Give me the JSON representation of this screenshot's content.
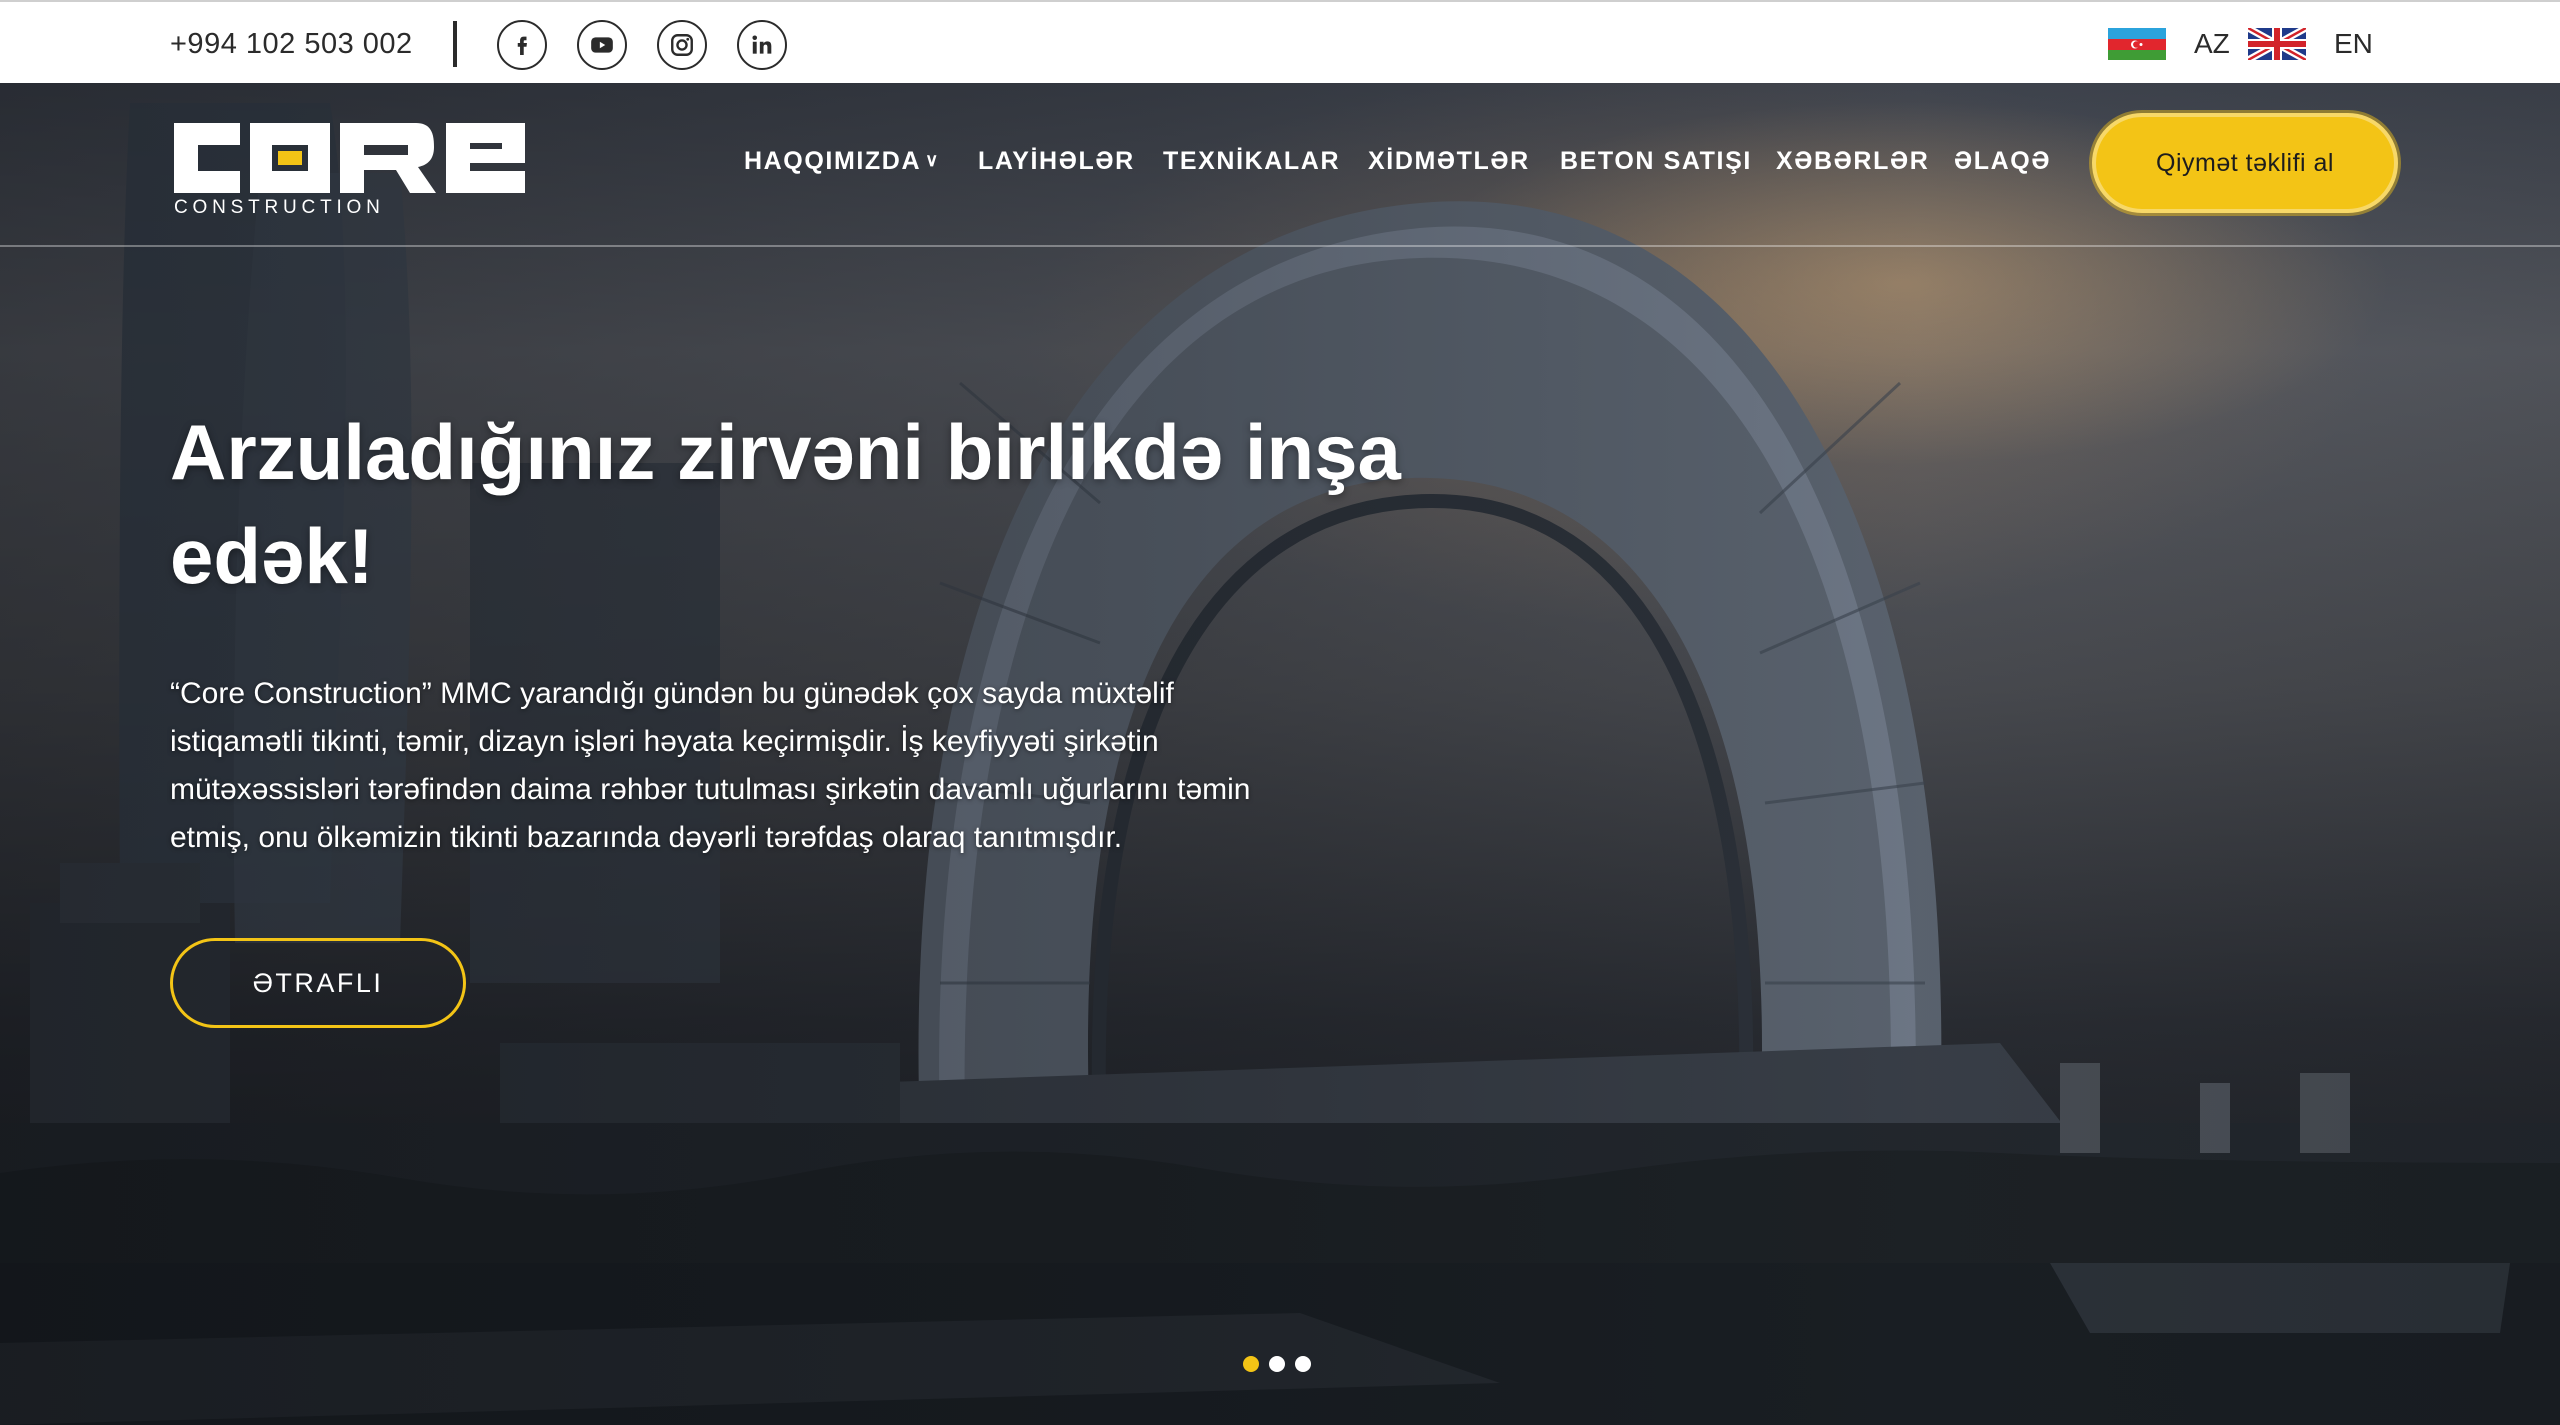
{
  "topbar": {
    "phone": "+994 102 503 002",
    "social": [
      "facebook-icon",
      "youtube-icon",
      "instagram-icon",
      "linkedin-icon"
    ],
    "languages": [
      {
        "code": "AZ",
        "flag": "azerbaijan-flag-icon"
      },
      {
        "code": "EN",
        "flag": "uk-flag-icon"
      }
    ]
  },
  "brand": {
    "name": "CORE",
    "tagline": "CONSTRUCTION",
    "accent_color": "#f3c416"
  },
  "nav": {
    "items": [
      {
        "label": "HAQQIMIZDA",
        "has_dropdown": true
      },
      {
        "label": "LAYİHƏLƏR"
      },
      {
        "label": "TEXNİKALAR"
      },
      {
        "label": "XİDMƏTLƏR"
      },
      {
        "label": "BETON SATIŞI"
      },
      {
        "label": "XƏBƏRLƏR"
      },
      {
        "label": "ƏLAQƏ"
      }
    ],
    "cta_label": "Qiymət təklifi al"
  },
  "hero": {
    "headline_line1": "Arzuladığınız zirvəni birlikdə inşa",
    "headline_line2": "edək!",
    "lead_lines": [
      "“Core Construction” MMC yarandığı gündən bu günədək çox sayda müxtəlif",
      "istiqamətli tikinti, təmir, dizayn işləri həyata keçirmişdir. İş keyfiyyəti şirkətin",
      "mütəxəssisləri tərəfindən daima rəhbər tutulması şirkətin davamlı uğurlarını təmin",
      "etmiş, onu ölkəmizin tikinti bazarında dəyərli tərəfdaş olaraq tanıtmışdır."
    ],
    "more_label": "ƏTRAFLI",
    "slider": {
      "total": 3,
      "active": 1
    }
  }
}
